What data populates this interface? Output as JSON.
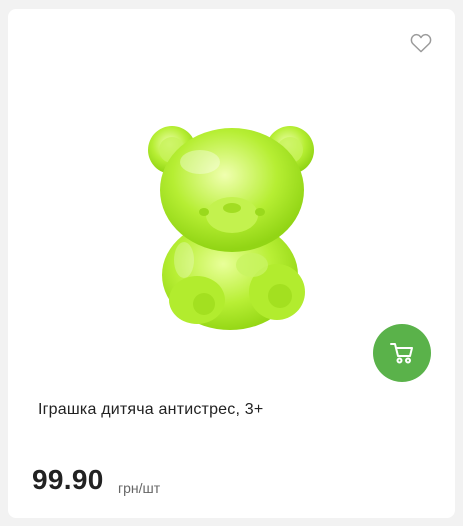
{
  "product": {
    "name": "Іграшка дитяча антистрес, 3+",
    "price": "99.90",
    "unit": "грн/шт"
  },
  "icons": {
    "favorite": "heart-outline-icon",
    "cart": "shopping-cart-icon"
  },
  "colors": {
    "accent": "#5ab24a",
    "toy": "#a6e22a",
    "heart_stroke": "#9a9a9a"
  }
}
